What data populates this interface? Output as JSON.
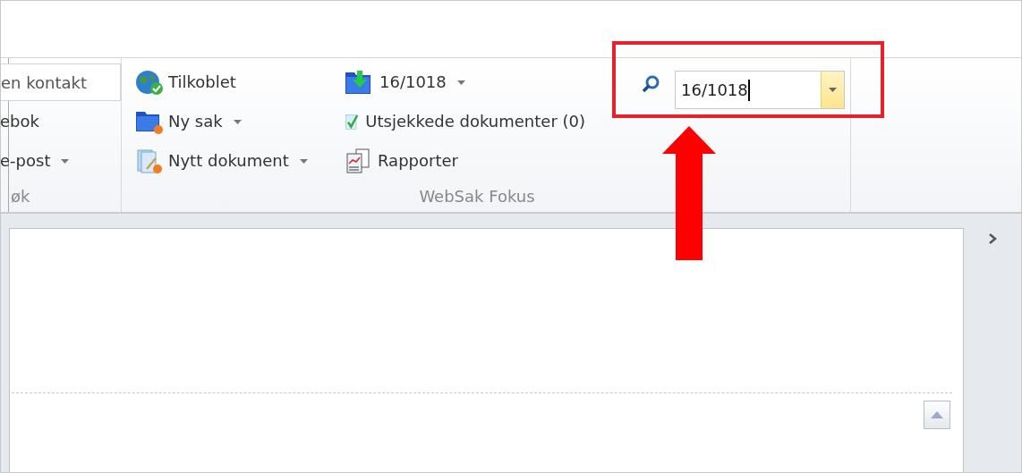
{
  "ribbon": {
    "groups": [
      {
        "label": "øk",
        "items": [
          {
            "kind": "field",
            "label": "en kontakt"
          },
          {
            "kind": "button",
            "label": "ebok"
          },
          {
            "kind": "dropdown",
            "label": "e-post"
          }
        ]
      },
      {
        "label": "WebSak Fokus",
        "columns": [
          [
            {
              "kind": "button",
              "label": "Tilkoblet"
            },
            {
              "kind": "dropdown",
              "label": "Ny sak"
            },
            {
              "kind": "dropdown",
              "label": "Nytt dokument"
            }
          ],
          [
            {
              "kind": "dropdown",
              "label": "16/1018"
            },
            {
              "kind": "button",
              "label": "Utsjekkede dokumenter (0)"
            },
            {
              "kind": "button",
              "label": "Rapporter"
            }
          ]
        ],
        "search": {
          "value": "16/1018"
        }
      }
    ]
  }
}
